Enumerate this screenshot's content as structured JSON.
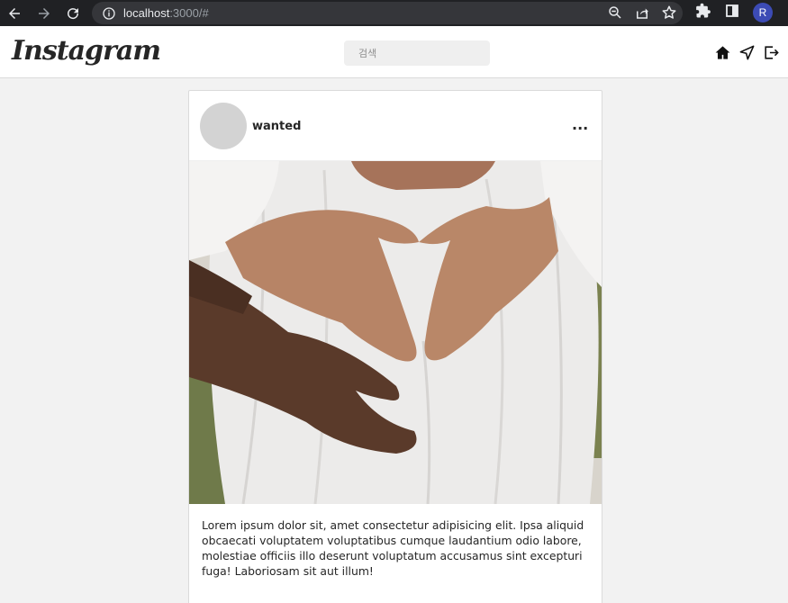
{
  "browser": {
    "url_host": "localhost",
    "url_rest": ":3000/#",
    "profile_initial": "R",
    "icons": [
      "back-icon",
      "forward-icon",
      "reload-icon",
      "info-icon",
      "zoom-icon",
      "share-icon",
      "star-icon",
      "extensions-icon",
      "sidepanel-icon"
    ]
  },
  "header": {
    "logo": "Instagram",
    "search_placeholder": "검색",
    "icons": [
      "home-icon",
      "send-icon",
      "logout-icon"
    ]
  },
  "post": {
    "username": "wanted",
    "more_label": "...",
    "caption": "Lorem ipsum dolor sit, amet consectetur adipisicing elit. Ipsa aliquid obcaecati voluptatem voluptatibus cumque laudantium odio labore, molestiae officiis illo deserunt voluptatum accusamus sint excepturi fuga! Laboriosam sit aut illum!"
  },
  "colors": {
    "chrome_bg": "#202124",
    "omnibox_bg": "#35363a",
    "page_bg": "#f2f2f2",
    "avatar": "#d3d3d3"
  }
}
